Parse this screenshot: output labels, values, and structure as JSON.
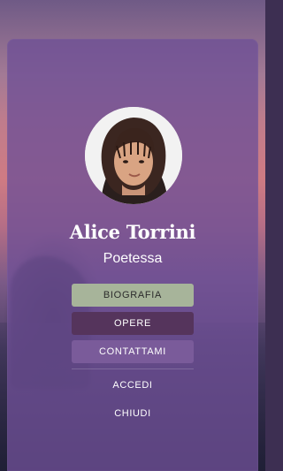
{
  "profile": {
    "name": "Alice Torrini",
    "role": "Poetessa"
  },
  "menu": {
    "biografia": "BIOGRAFIA",
    "opere": "OPERE",
    "contattami": "CONTATTAMI"
  },
  "actions": {
    "accedi": "ACCEDI",
    "chiudi": "CHIUDI"
  },
  "colors": {
    "card": "#6e5096",
    "button_biografia": "#a7b49a",
    "button_opere": "#55345c",
    "button_contattami": "#7a5b9a"
  }
}
